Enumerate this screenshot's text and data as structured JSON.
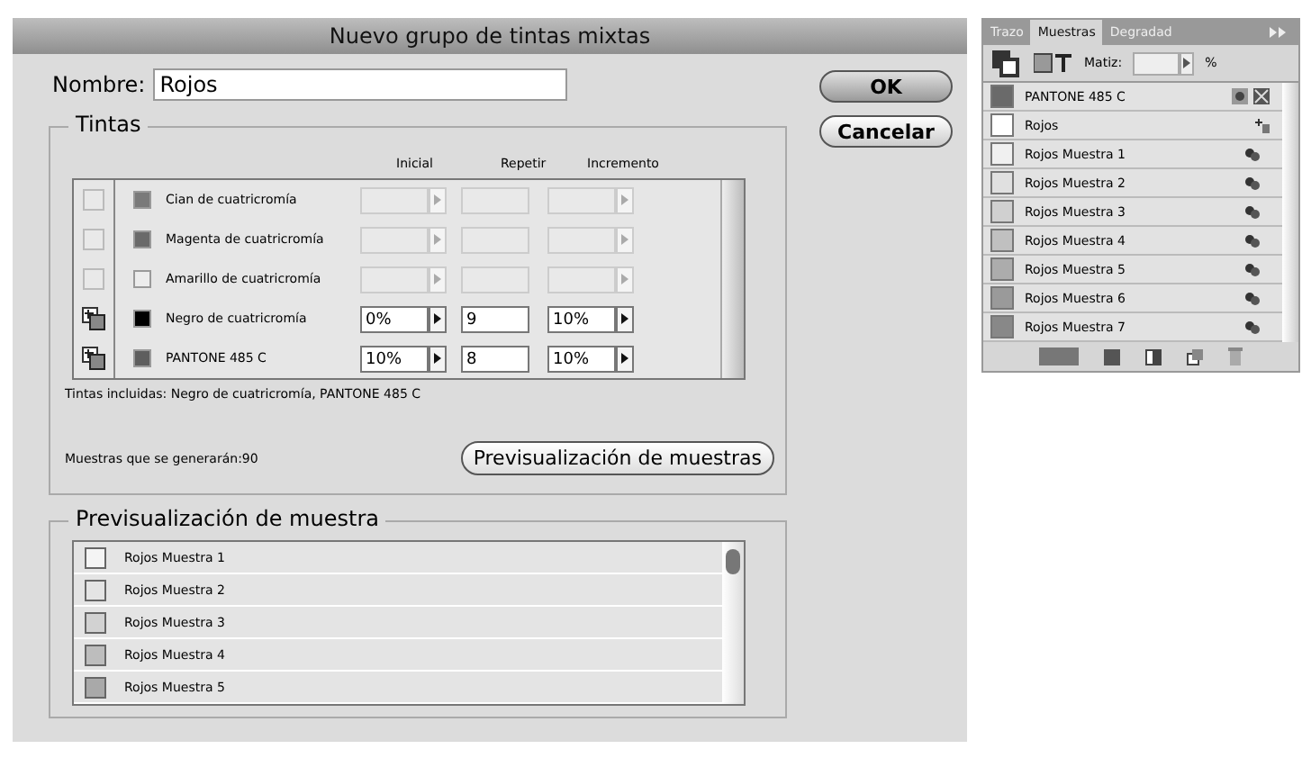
{
  "window": {
    "title": "Nuevo grupo de tintas mixtas"
  },
  "name_field": {
    "label": "Nombre:",
    "value": "Rojos"
  },
  "buttons": [
    {
      "label": "OK",
      "kind": "default"
    },
    {
      "label": "Cancelar",
      "kind": "normal"
    }
  ],
  "inks": {
    "title": "Tintas",
    "columns": [
      "Inicial",
      "Repetir",
      "Incremento"
    ],
    "rows": [
      {
        "name": "Cian de cuatricromía",
        "included": false,
        "color": "#7a7a7a",
        "inicial": "",
        "repetir": "",
        "incremento": ""
      },
      {
        "name": "Magenta de cuatricromía",
        "included": false,
        "color": "#6a6a6a",
        "inicial": "",
        "repetir": "",
        "incremento": ""
      },
      {
        "name": "Amarillo de cuatricromía",
        "included": false,
        "color": "#ececec",
        "inicial": "",
        "repetir": "",
        "incremento": ""
      },
      {
        "name": "Negro de cuatricromía",
        "included": true,
        "color": "#000000",
        "inicial": "0%",
        "repetir": "9",
        "incremento": "10%"
      },
      {
        "name": "PANTONE 485 C",
        "included": true,
        "color": "#5e5e5e",
        "inicial": "10%",
        "repetir": "8",
        "incremento": "10%"
      }
    ],
    "included_text": "Tintas incluidas: Negro de cuatricromía, PANTONE 485 C",
    "count_text": "Muestras que se generarán:90",
    "preview_button": "Previsualización de muestras"
  },
  "preview": {
    "title": "Previsualización de muestra",
    "items": [
      {
        "name": "Rojos Muestra 1",
        "color": "#f4f4f4"
      },
      {
        "name": "Rojos Muestra 2",
        "color": "#e4e4e4"
      },
      {
        "name": "Rojos Muestra 3",
        "color": "#d2d2d2"
      },
      {
        "name": "Rojos Muestra 4",
        "color": "#bdbdbd"
      },
      {
        "name": "Rojos Muestra 5",
        "color": "#a9a9a9"
      }
    ]
  },
  "swatches_panel": {
    "tabs": [
      {
        "label": "Trazo",
        "selected": false
      },
      {
        "label": "Muestras",
        "selected": true
      },
      {
        "label": "Degradad",
        "selected": false
      }
    ],
    "tint_label": "Matiz:",
    "tint_unit": "%",
    "items": [
      {
        "name": "PANTONE 485 C",
        "kind": "spot",
        "color": "#6a6a6a"
      },
      {
        "name": "Rojos",
        "kind": "group",
        "color": "#ffffff"
      },
      {
        "name": "Rojos Muestra 1",
        "kind": "sample",
        "color": "#f0f0f0"
      },
      {
        "name": "Rojos Muestra 2",
        "kind": "sample",
        "color": "#e0e0e0"
      },
      {
        "name": "Rojos Muestra 3",
        "kind": "sample",
        "color": "#d0d0d0"
      },
      {
        "name": "Rojos Muestra 4",
        "kind": "sample",
        "color": "#c0c0c0"
      },
      {
        "name": "Rojos Muestra 5",
        "kind": "sample",
        "color": "#acacac"
      },
      {
        "name": "Rojos Muestra 6",
        "kind": "sample",
        "color": "#9a9a9a"
      },
      {
        "name": "Rojos Muestra 7",
        "kind": "sample",
        "color": "#888888"
      }
    ]
  }
}
